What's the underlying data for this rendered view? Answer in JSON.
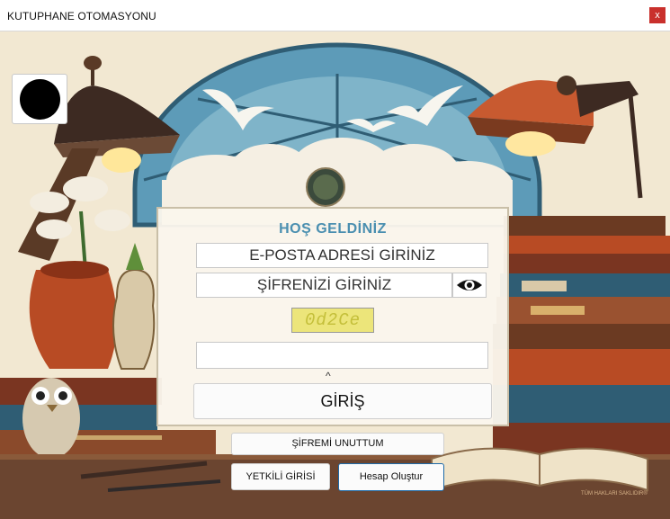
{
  "window": {
    "title": "KUTUPHANE OTOMASYONU",
    "close_label": "x"
  },
  "login": {
    "welcome": "HOŞ GELDİNİZ",
    "email_placeholder": "E-POSTA ADRESİ GİRİNİZ",
    "password_placeholder": "ŞİFRENİZİ GİRİNİZ",
    "captcha_code": "0d2Ce",
    "captcha_input_value": "",
    "caret": "^",
    "login_button": "GİRİŞ",
    "forgot_button": "ŞİFREMİ UNUTTUM",
    "admin_button": "YETKİLİ GİRİSİ",
    "create_button": "Hesap Oluştur"
  },
  "footer": {
    "copyright": "TÜM HAKLARI SAKLIDIR®"
  },
  "colors": {
    "welcome": "#4a8fb0",
    "close": "#c9302c",
    "captcha_bg": "#ece57a",
    "accent_border": "#1e6aa8"
  },
  "icons": {
    "eye": "eye-icon",
    "avatar": "avatar-icon"
  }
}
